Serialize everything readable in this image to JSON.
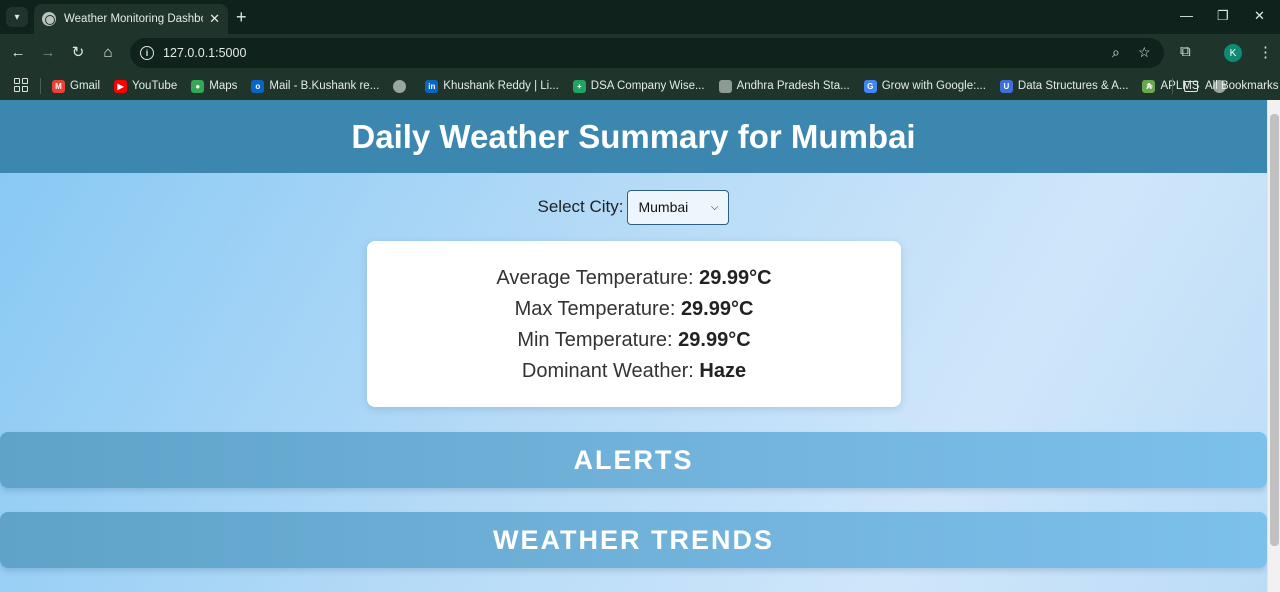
{
  "browser": {
    "tab_title": "Weather Monitoring Dashboard",
    "url": "127.0.0.1:5000",
    "profile_initial": "K",
    "bookmarks": [
      {
        "label": "Gmail",
        "icon": "gmail-icon",
        "color": "#ea4335",
        "glyph": "M"
      },
      {
        "label": "YouTube",
        "icon": "youtube-icon",
        "color": "#ff0000",
        "glyph": "▶"
      },
      {
        "label": "Maps",
        "icon": "maps-icon",
        "color": "#34a853",
        "glyph": "●"
      },
      {
        "label": "Mail - B.Kushank re...",
        "icon": "outlook-icon",
        "color": "#0a64c8",
        "glyph": "o"
      },
      {
        "label": "",
        "icon": "globe-icon",
        "color": "#9aa5a0",
        "glyph": ""
      },
      {
        "label": "Khushank Reddy | Li...",
        "icon": "linkedin-icon",
        "color": "#0a66c2",
        "glyph": "in"
      },
      {
        "label": "DSA Company Wise...",
        "icon": "sheets-icon",
        "color": "#1ea362",
        "glyph": "+"
      },
      {
        "label": "Andhra Pradesh Sta...",
        "icon": "image-icon",
        "color": "#8d9b95",
        "glyph": ""
      },
      {
        "label": "Grow with Google:...",
        "icon": "google-icon",
        "color": "#4285f4",
        "glyph": "G"
      },
      {
        "label": "Data Structures & A...",
        "icon": "udemy-icon",
        "color": "#3e6fd8",
        "glyph": "U"
      },
      {
        "label": "APLMS",
        "icon": "aplms-icon",
        "color": "#6aa84f",
        "glyph": "A"
      },
      {
        "label": "",
        "icon": "globe-icon",
        "color": "#9aa5a0",
        "glyph": ""
      }
    ],
    "all_bookmarks": "All Bookmarks"
  },
  "page": {
    "title": "Daily Weather Summary for Mumbai",
    "city_label": "Select City:",
    "city_selected": "Mumbai",
    "summary": {
      "avg_label": "Average Temperature:",
      "avg_value": "29.99°C",
      "max_label": "Max Temperature:",
      "max_value": "29.99°C",
      "min_label": "Min Temperature:",
      "min_value": "29.99°C",
      "weather_label": "Dominant Weather:",
      "weather_value": "Haze"
    },
    "alerts_title": "ALERTS",
    "trends_title": "WEATHER TRENDS"
  },
  "colors": {
    "header_bg": "#3b87b0",
    "chrome_dark": "#0f231c",
    "chrome_toolbar": "#1f352c"
  }
}
